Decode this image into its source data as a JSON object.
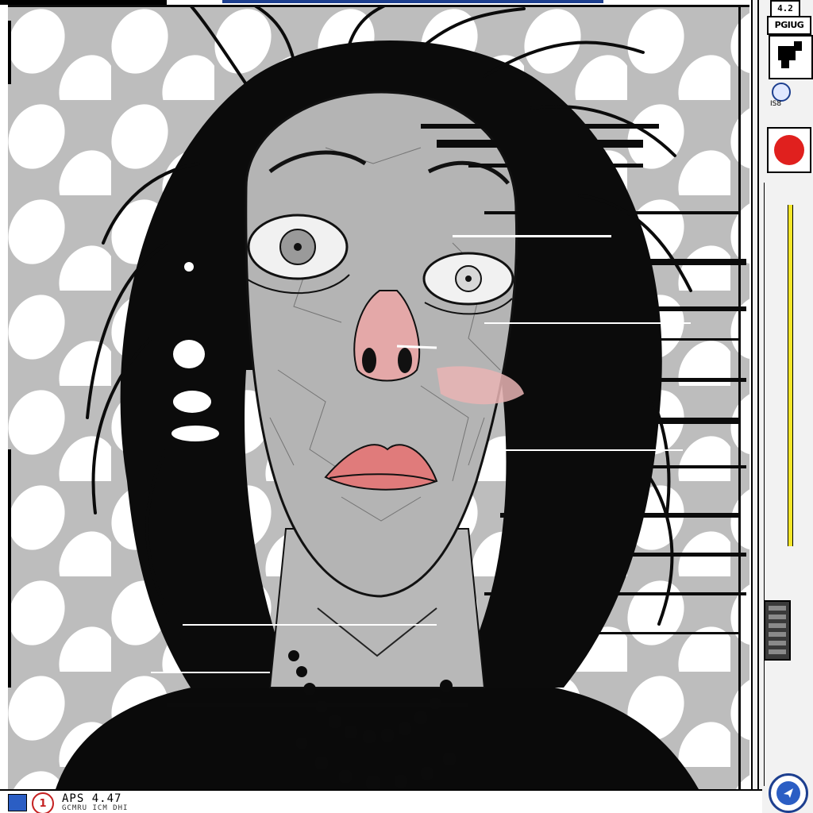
{
  "sidebar": {
    "top_code": "4.2",
    "label": "PGIUG",
    "knob_label": "IS8"
  },
  "status_bar": {
    "app_code": "APS 4.47",
    "badge": "1",
    "sub_text": "GCMRU ICM DHI"
  },
  "colors": {
    "record": "#e0201e",
    "accent_blue": "#2b5ec4",
    "track_yellow": "#f3e62a"
  },
  "icons": [
    "monitor-icon",
    "record-icon",
    "settings-knob-icon",
    "navigation-arrow-icon",
    "alert-badge-icon"
  ]
}
